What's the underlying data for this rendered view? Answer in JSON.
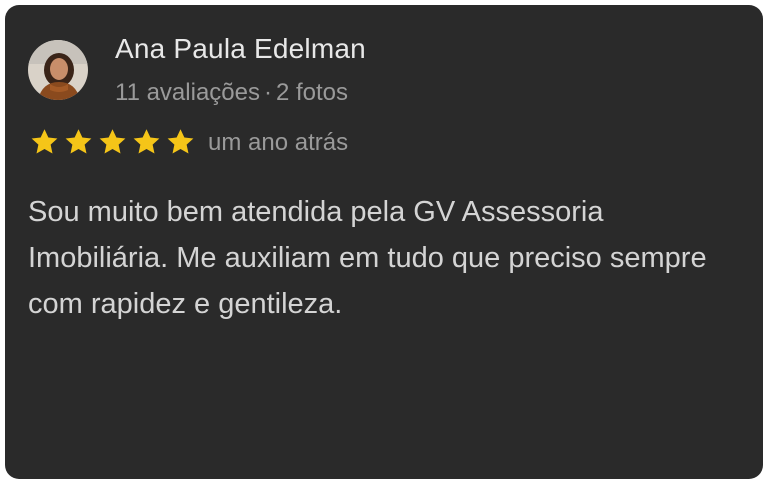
{
  "review": {
    "author_name": "Ana Paula Edelman",
    "review_count": "11 avaliações",
    "separator": "·",
    "photo_count": "2 fotos",
    "rating": 5,
    "rating_max": 5,
    "time_ago": "um ano atrás",
    "text": "Sou muito bem atendida pela GV Assessoria Imobiliária. Me auxiliam em tudo que preciso sempre com rapidez e gentileza."
  },
  "icons": {
    "avatar": "avatar-photo",
    "star": "star-icon"
  },
  "colors": {
    "card_background": "#2a2a2a",
    "star": "#f5c518",
    "name": "#e8e8e8",
    "secondary_text": "#9a9a9a",
    "body_text": "#d4d4d4"
  }
}
